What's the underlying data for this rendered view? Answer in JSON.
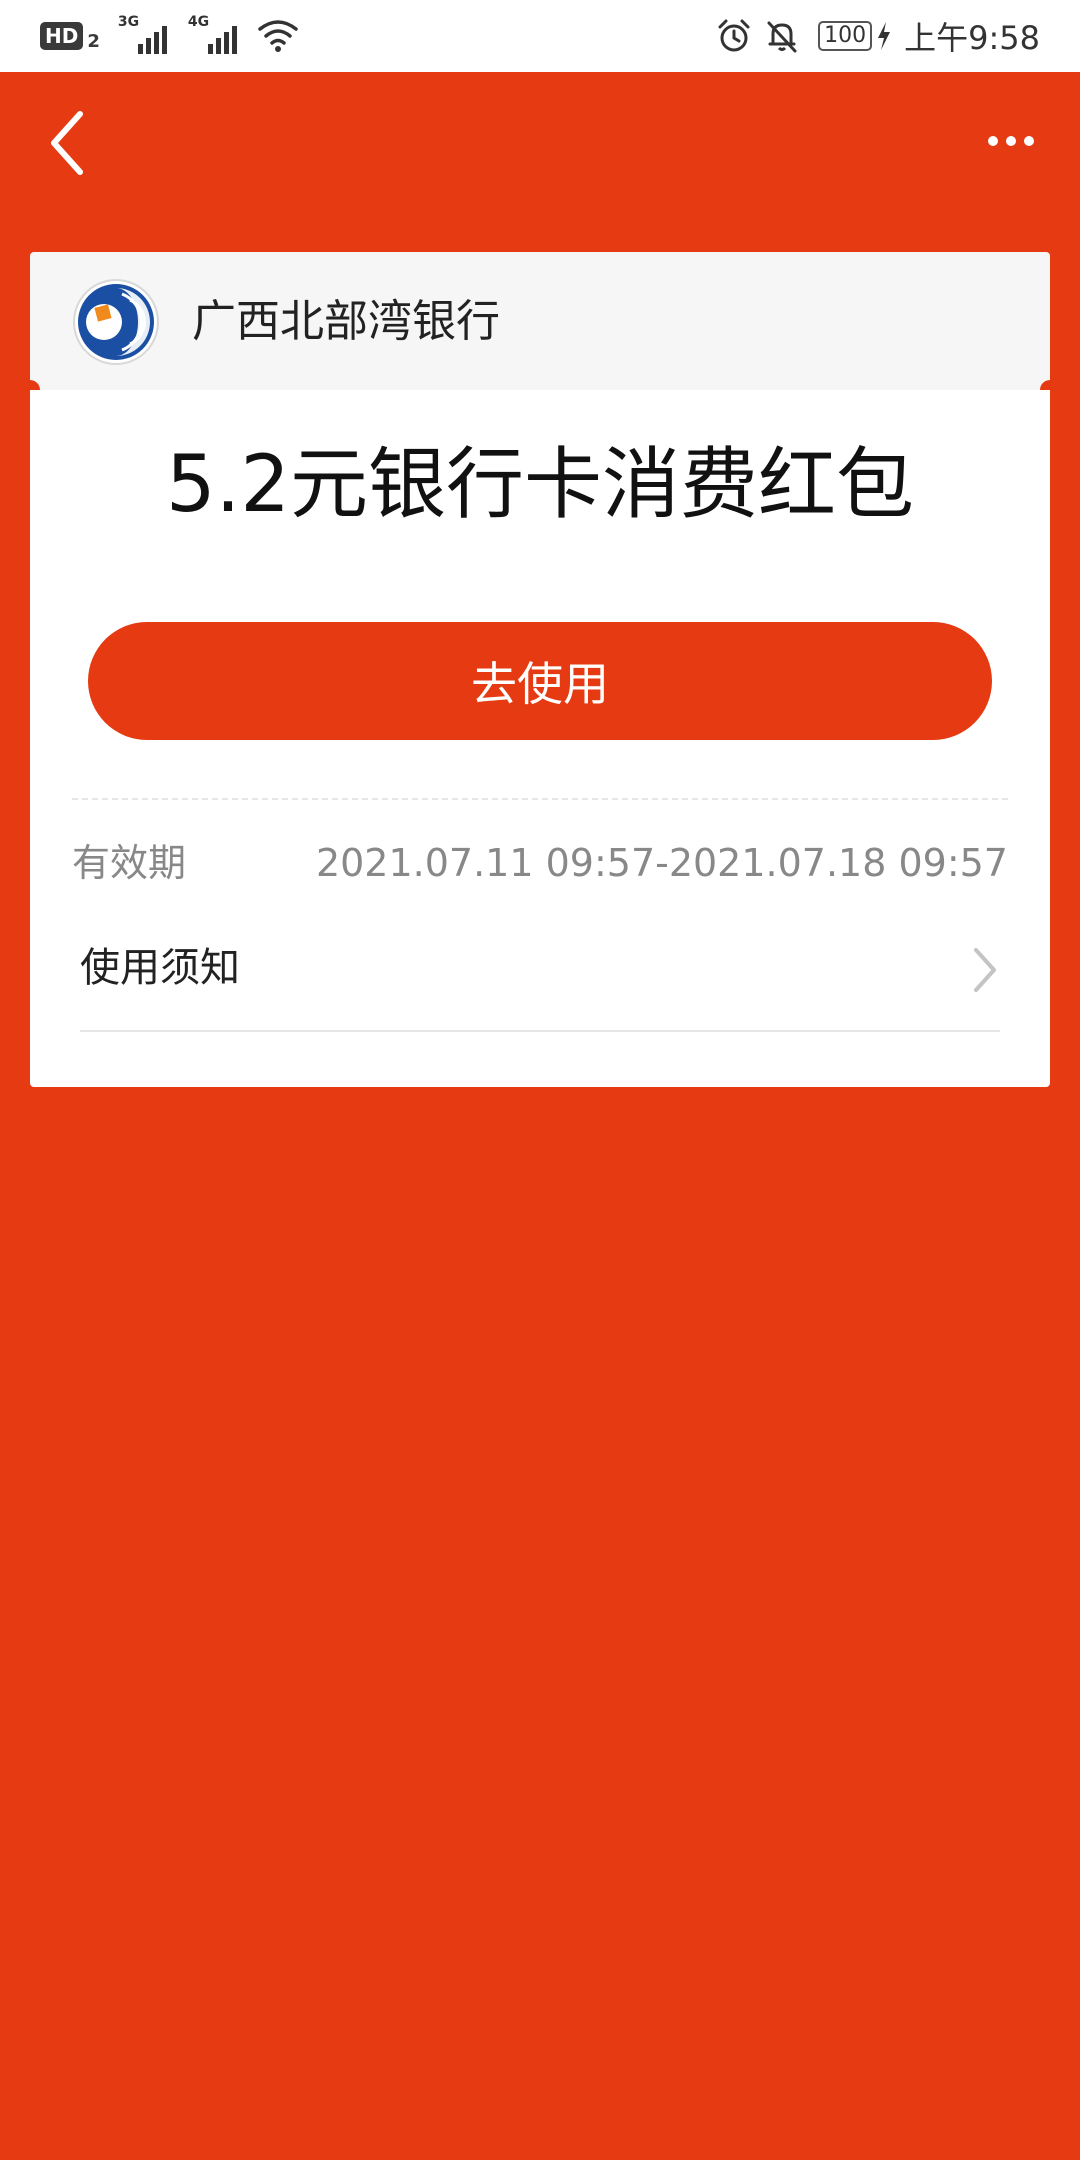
{
  "status_bar": {
    "hd_label": "HD",
    "hd_sub": "2",
    "signal1_type": "3G",
    "signal2_type": "4G",
    "battery": "100",
    "time": "上午9:58",
    "icons": [
      "wifi-icon",
      "alarm-icon",
      "bell-off-icon",
      "battery-icon",
      "charging-icon"
    ]
  },
  "app_bar": {
    "back_icon": "chevron-left-icon",
    "more_icon": "more-horizontal-icon"
  },
  "card": {
    "bank_name": "广西北部湾银行",
    "title": "5.2元银行卡消费红包",
    "use_button_label": "去使用",
    "validity_label": "有效期",
    "validity_value": "2021.07.11 09:57-2021.07.18 09:57",
    "notice_label": "使用须知"
  },
  "colors": {
    "primary": "#E53A12",
    "card_header_bg": "#F6F6F6",
    "muted_text": "#888888",
    "logo_blue": "#1B4FA3",
    "logo_orange": "#F08A1C"
  }
}
